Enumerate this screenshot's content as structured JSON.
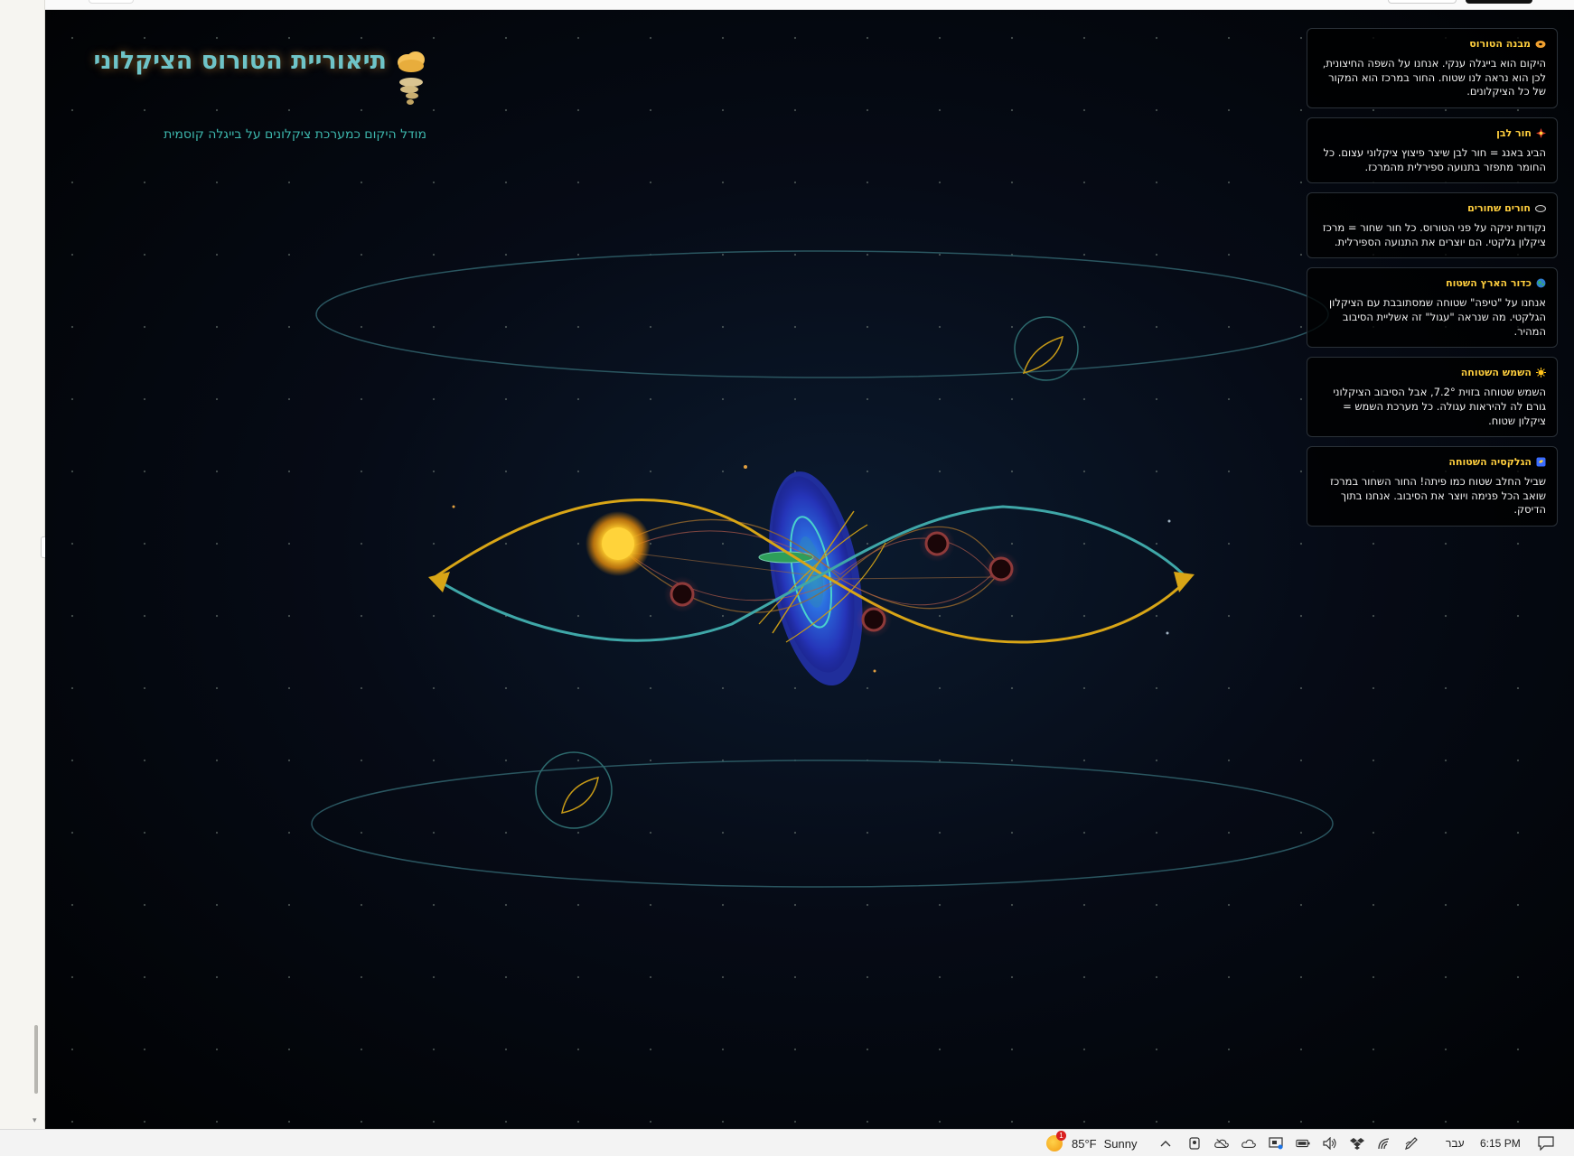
{
  "title": {
    "heading": "תיאוריית הטורוס הציקלוני",
    "subtitle": "מודל היקום כמערכת ציקלונים על בייגלה קוסמית",
    "icons": [
      "cloud-icon",
      "tornado-icon"
    ]
  },
  "cards": [
    {
      "icon": "bagel-icon",
      "color": "#f0a030",
      "heading": "מבנה הטורוס",
      "body": "היקום הוא בייגלה ענקי. אנחנו על השפה החיצונית, לכן הוא נראה לנו שטוח. החור במרכז הוא המקור של כל הציקלונים."
    },
    {
      "icon": "burst-icon",
      "color": "#e03b2a",
      "heading": "חור לבן",
      "body": "הביג באנג = חור לבן שיצר פיצוץ ציקלוני עצום. כל החומר מתפזר בתנועה ספירלית מהמרכז."
    },
    {
      "icon": "hole-icon",
      "color": "#cfcfcf",
      "heading": "חורים שחורים",
      "body": "נקודות יניקה על פני הטורוס. כל חור שחור = מרכז ציקלון גלקטי. הם יוצרים את התנועה הספירלית."
    },
    {
      "icon": "globe-icon",
      "color": "#2e9e5a",
      "heading": "כדור הארץ השטוח",
      "body": "אנחנו על \"טיפה\" שטוחה שמסתובבת עם הציקלון הגלקטי. מה שנראה \"עגול\" זה אשליית הסיבוב המהיר."
    },
    {
      "icon": "sun-icon",
      "color": "#ffc21a",
      "heading": "השמש השטוחה",
      "body": "השמש שטוחה בזוית 7.2°, אבל הסיבוב הציקלוני גורם לה להיראות עגולה. כל מערכת השמש = ציקלון שטוח."
    },
    {
      "icon": "galaxy-icon",
      "color": "#3a6cff",
      "heading": "הגלקסיה השטוחה",
      "body": "שביל החלב שטוח כמו פיתה! החור השחור במרכז שואב הכל פנימה ויוצר את הסיבוב. אנחנו בתוך הדיסק."
    }
  ],
  "colors": {
    "gold": "#d8a516",
    "teal": "#3fa7a8",
    "ring": "#2a5660",
    "galaxy_blue": "#2f49d8",
    "title_teal": "#6ec4c8",
    "card_heading": "#ffcf3e"
  },
  "taskbar": {
    "weather_badge": "1",
    "temperature": "85°F",
    "condition": "Sunny",
    "language": "עבר",
    "time": "6:15 PM",
    "tray_icons": [
      "chevron-up-icon",
      "meet-now-icon",
      "onedrive-off-icon",
      "onedrive-icon",
      "display-icon",
      "battery-icon",
      "volume-icon",
      "dropbox-icon",
      "wifi-icon",
      "pen-icon"
    ]
  }
}
